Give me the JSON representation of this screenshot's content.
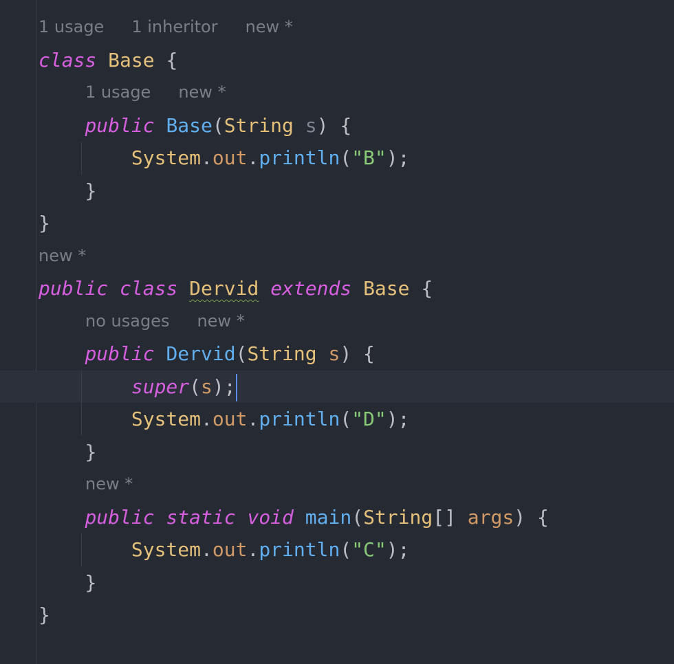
{
  "colors": {
    "background": "#262a33",
    "keyword": "#d55fde",
    "class": "#e5c07b",
    "method": "#61afef",
    "string": "#89ca78",
    "hint": "#7a7e85",
    "caret": "#5a8cf0"
  },
  "lines": [
    {
      "hint": [
        "1 usage",
        "1 inheritor",
        "new *"
      ],
      "indent": 0
    },
    {
      "indent": 0,
      "tokens": [
        [
          "kw",
          "class"
        ],
        [
          "punc",
          " "
        ],
        [
          "cls",
          "Base"
        ],
        [
          "punc",
          " {"
        ]
      ]
    },
    {
      "hint": [
        "1 usage",
        "new *"
      ],
      "indent": 1
    },
    {
      "indent": 1,
      "tokens": [
        [
          "kw",
          "public"
        ],
        [
          "punc",
          " "
        ],
        [
          "fn",
          "Base"
        ],
        [
          "punc",
          "("
        ],
        [
          "cls",
          "String"
        ],
        [
          "punc",
          " "
        ],
        [
          "unused",
          "s"
        ],
        [
          "punc",
          ") {"
        ]
      ]
    },
    {
      "indent": 2,
      "guide": true,
      "tokens": [
        [
          "cls",
          "System"
        ],
        [
          "punc",
          "."
        ],
        [
          "fld",
          "out"
        ],
        [
          "punc",
          "."
        ],
        [
          "fn",
          "println"
        ],
        [
          "punc",
          "("
        ],
        [
          "str",
          "\"B\""
        ],
        [
          "punc",
          ");"
        ]
      ]
    },
    {
      "indent": 1,
      "tokens": [
        [
          "punc",
          "}"
        ]
      ]
    },
    {
      "indent": 0,
      "tokens": [
        [
          "punc",
          "}"
        ]
      ]
    },
    {
      "hint": [
        "new *"
      ],
      "indent": 0
    },
    {
      "indent": 0,
      "tokens": [
        [
          "kw",
          "public"
        ],
        [
          "punc",
          " "
        ],
        [
          "kw",
          "class"
        ],
        [
          "punc",
          " "
        ],
        [
          "cls warn",
          "Dervid"
        ],
        [
          "punc",
          " "
        ],
        [
          "kw",
          "extends"
        ],
        [
          "punc",
          " "
        ],
        [
          "cls",
          "Base"
        ],
        [
          "punc",
          " {"
        ]
      ]
    },
    {
      "hint": [
        "no usages",
        "new *"
      ],
      "indent": 1
    },
    {
      "indent": 1,
      "tokens": [
        [
          "kw",
          "public"
        ],
        [
          "punc",
          " "
        ],
        [
          "fn",
          "Dervid"
        ],
        [
          "punc",
          "("
        ],
        [
          "cls",
          "String"
        ],
        [
          "punc",
          " "
        ],
        [
          "param",
          "s"
        ],
        [
          "punc",
          ") {"
        ]
      ]
    },
    {
      "indent": 2,
      "guide": true,
      "current": true,
      "caret": true,
      "tokens": [
        [
          "kw",
          "super"
        ],
        [
          "punc",
          "("
        ],
        [
          "param",
          "s"
        ],
        [
          "punc",
          ");"
        ]
      ]
    },
    {
      "indent": 2,
      "guide": true,
      "tokens": [
        [
          "cls",
          "System"
        ],
        [
          "punc",
          "."
        ],
        [
          "fld",
          "out"
        ],
        [
          "punc",
          "."
        ],
        [
          "fn",
          "println"
        ],
        [
          "punc",
          "("
        ],
        [
          "str",
          "\"D\""
        ],
        [
          "punc",
          ");"
        ]
      ]
    },
    {
      "indent": 1,
      "tokens": [
        [
          "punc",
          "}"
        ]
      ]
    },
    {
      "hint": [
        "new *"
      ],
      "indent": 1
    },
    {
      "indent": 1,
      "tokens": [
        [
          "kw",
          "public"
        ],
        [
          "punc",
          " "
        ],
        [
          "kw",
          "static"
        ],
        [
          "punc",
          " "
        ],
        [
          "kw",
          "void"
        ],
        [
          "punc",
          " "
        ],
        [
          "fn",
          "main"
        ],
        [
          "punc",
          "("
        ],
        [
          "cls",
          "String"
        ],
        [
          "punc",
          "[] "
        ],
        [
          "param",
          "args"
        ],
        [
          "punc",
          ") {"
        ]
      ]
    },
    {
      "indent": 2,
      "guide": true,
      "tokens": [
        [
          "cls",
          "System"
        ],
        [
          "punc",
          "."
        ],
        [
          "fld",
          "out"
        ],
        [
          "punc",
          "."
        ],
        [
          "fn",
          "println"
        ],
        [
          "punc",
          "("
        ],
        [
          "str",
          "\"C\""
        ],
        [
          "punc",
          ");"
        ]
      ]
    },
    {
      "indent": 1,
      "tokens": [
        [
          "punc",
          "}"
        ]
      ]
    },
    {
      "indent": 0,
      "tokens": [
        [
          "punc",
          "}"
        ]
      ]
    }
  ]
}
